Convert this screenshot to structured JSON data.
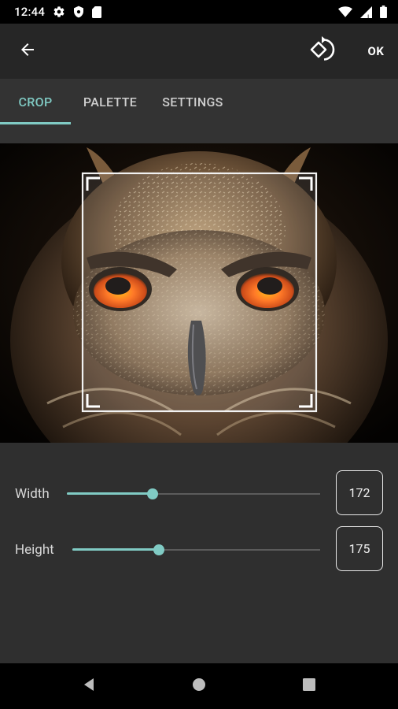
{
  "status_bar": {
    "time": "12:44",
    "left_icons": [
      "gear-icon",
      "shield-icon",
      "sd-card-icon"
    ],
    "right_icons": [
      "wifi-icon",
      "cellular-signal-icon",
      "battery-icon"
    ]
  },
  "toolbar": {
    "back_icon": "arrow-back-icon",
    "rotate_icon": "rotate-left-icon",
    "ok_label": "OK"
  },
  "tabs": [
    {
      "label": "CROP",
      "active": true
    },
    {
      "label": "PALETTE",
      "active": false
    },
    {
      "label": "SETTINGS",
      "active": false
    }
  ],
  "crop": {
    "image_subject": "owl",
    "width_label": "Width",
    "width_value": "172",
    "width_slider_fraction": 0.34,
    "height_label": "Height",
    "height_value": "175",
    "height_slider_fraction": 0.35
  },
  "colors": {
    "accent": "#80cbc4",
    "background": "#2f2f2f",
    "toolbar": "#262626",
    "owl_eye": "#ff5a0a"
  },
  "nav_bar": {
    "icons": [
      "back-triangle-icon",
      "home-circle-icon",
      "recents-square-icon"
    ]
  }
}
